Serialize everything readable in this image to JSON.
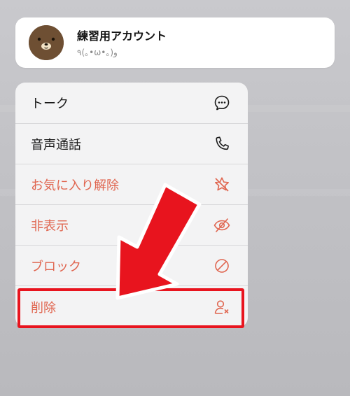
{
  "profile": {
    "name": "練習用アカウント",
    "status": "٩(｡•ω•｡)و",
    "avatar_icon": "brown-bear-avatar"
  },
  "menu": {
    "items": [
      {
        "label": "トーク",
        "icon": "chat-bubble-icon",
        "style": "normal"
      },
      {
        "label": "音声通話",
        "icon": "phone-icon",
        "style": "normal"
      },
      {
        "label": "お気に入り解除",
        "icon": "star-slash-icon",
        "style": "danger"
      },
      {
        "label": "非表示",
        "icon": "eye-slash-icon",
        "style": "danger"
      },
      {
        "label": "ブロック",
        "icon": "block-icon",
        "style": "danger"
      },
      {
        "label": "削除",
        "icon": "delete-friend-icon",
        "style": "danger"
      }
    ]
  },
  "colors": {
    "danger": "#e0654f",
    "normal": "#1a1a1a",
    "annotation_red": "#e8141e",
    "menu_background": "#f3f3f4",
    "backdrop": "#c3c3c7"
  }
}
